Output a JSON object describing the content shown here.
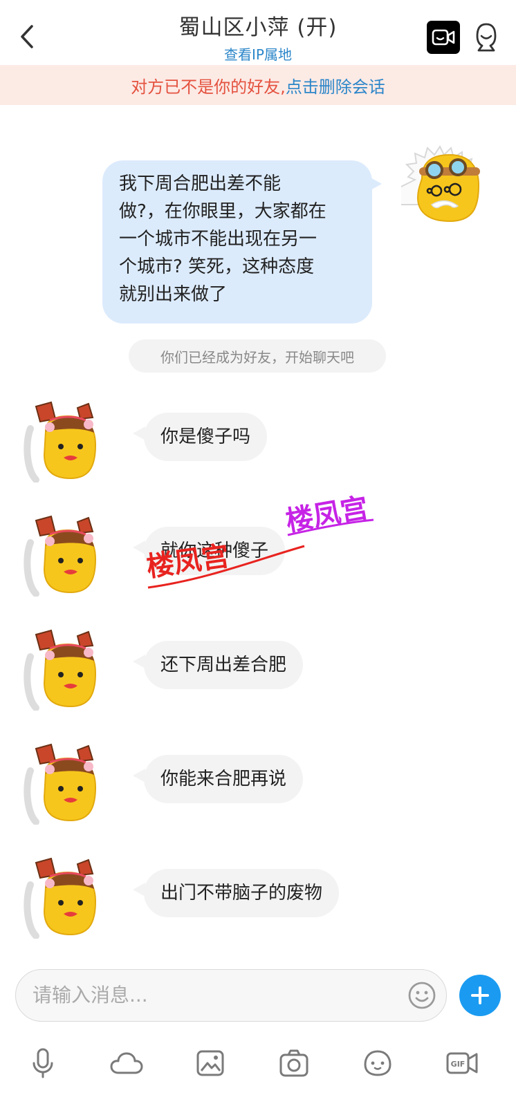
{
  "header": {
    "back_icon": "chevron-left-icon",
    "title": "蜀山区小萍 (开)",
    "subtitle": "查看IP属地",
    "video_icon": "video-call-icon",
    "profile_icon": "contact-profile-icon"
  },
  "notice": {
    "text": "对方已不是你的好友,",
    "link": "点击删除会话",
    "text_color": "#e4523f",
    "link_color": "#2b86c9"
  },
  "messages": {
    "outgoing": {
      "lines": [
        "我下周合肥出差不能",
        "做?，在你眼里，大家都在",
        "一个城市不能出现在另一",
        "个城市? 笑死，这种态度",
        "就别出来做了"
      ],
      "bubble_color": "#dcebfc"
    },
    "system": "你们已经成为好友，开始聊天吧",
    "incoming": [
      {
        "text": "你是傻子吗"
      },
      {
        "text": "就你这种傻子"
      },
      {
        "text": "还下周出差合肥"
      },
      {
        "text": "你能来合肥再说"
      },
      {
        "text": "出门不带脑子的废物"
      }
    ]
  },
  "watermark": {
    "text_1": "楼凤宫",
    "text_2": "楼凤宫",
    "color_1": "#e8231f",
    "color_2": "#c623e6"
  },
  "composer": {
    "placeholder": "请输入消息...",
    "emoji_icon": "smiley-icon",
    "add_icon": "plus-icon",
    "accent": "#1a9bf1"
  },
  "toolbar": {
    "items": [
      {
        "icon": "microphone-icon"
      },
      {
        "icon": "cloud-icon"
      },
      {
        "icon": "image-icon"
      },
      {
        "icon": "camera-icon"
      },
      {
        "icon": "sticker-face-icon"
      },
      {
        "icon": "gif-icon"
      }
    ]
  }
}
